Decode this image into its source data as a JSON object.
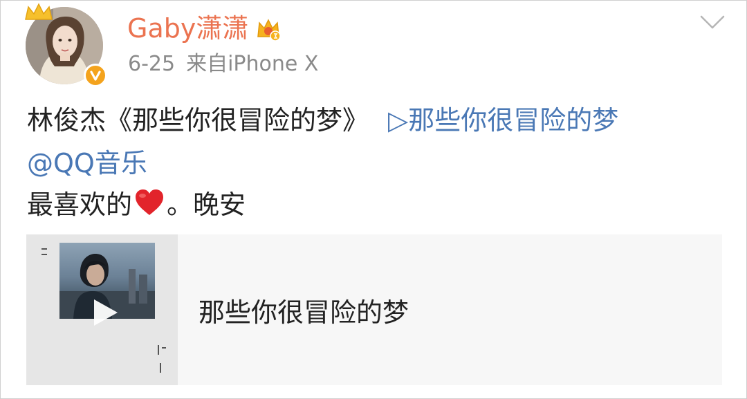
{
  "post": {
    "author": {
      "name": "Gaby潇潇",
      "avatar_icon": "avatar",
      "vip_icon": "crown-vip-icon",
      "verified_icon": "verified-badge-icon"
    },
    "date": "6-25",
    "source": "来自iPhone X",
    "text": {
      "line1_prefix": "林俊杰《那些你很冒险的梦》",
      "music_link": "▷那些你很冒险的梦",
      "mention": "@QQ音乐",
      "line3_before": "最喜欢的",
      "line3_after": "。晚安"
    },
    "menu_icon": "chevron-down-icon"
  },
  "card": {
    "title": "那些你很冒险的梦",
    "play_icon": "play-icon"
  },
  "colors": {
    "username": "#eb7350",
    "link": "#4a78b5",
    "meta": "#8a8a8a",
    "badge": "#f4a31d",
    "heart": "#e2242b"
  }
}
